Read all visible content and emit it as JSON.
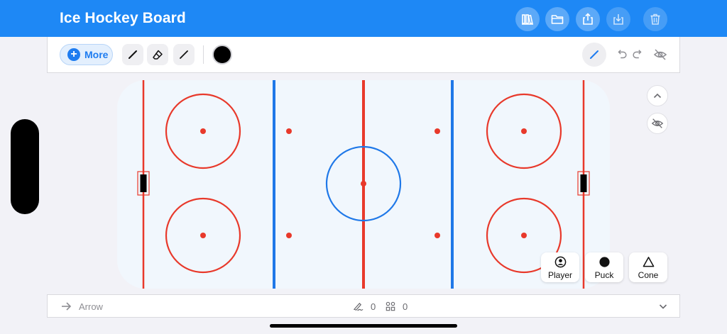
{
  "header": {
    "title": "Ice Hockey Board"
  },
  "toolbar": {
    "more_label": "More",
    "selected_color": "#000000"
  },
  "palette": {
    "player": "Player",
    "puck": "Puck",
    "cone": "Cone"
  },
  "status": {
    "tool_label": "Arrow",
    "drawings_count": "0",
    "objects_count": "0"
  },
  "colors": {
    "accent": "#1e88f5",
    "red_line": "#e8392b",
    "blue_line": "#1f78e8",
    "ice": "#f1f7fd"
  }
}
